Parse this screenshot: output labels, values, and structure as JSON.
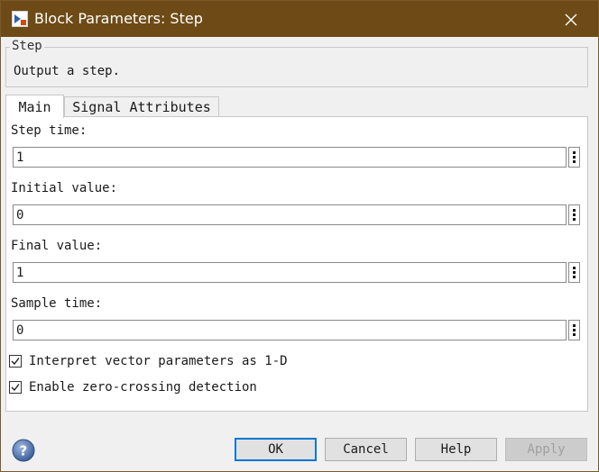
{
  "window": {
    "title": "Block Parameters: Step",
    "title_bar_color": "#6e4b16",
    "app_icon": "simulink-block-icon",
    "close_icon": "close-icon"
  },
  "description": {
    "group_label": "Step",
    "text": "Output a step."
  },
  "tabs": [
    {
      "label": "Main",
      "selected": true
    },
    {
      "label": "Signal Attributes",
      "selected": false
    }
  ],
  "parameters": [
    {
      "label": "Step time:",
      "value": "1"
    },
    {
      "label": "Initial value:",
      "value": "0"
    },
    {
      "label": "Final value:",
      "value": "1"
    },
    {
      "label": "Sample time:",
      "value": "0"
    }
  ],
  "checkboxes": [
    {
      "label": "Interpret vector parameters as 1-D",
      "checked": true
    },
    {
      "label": "Enable zero-crossing detection",
      "checked": true
    }
  ],
  "buttons": {
    "ok": "OK",
    "cancel": "Cancel",
    "help": "Help",
    "apply": "Apply"
  },
  "colors": {
    "accent": "#0078d7",
    "help_icon": "#4a6ea8"
  }
}
